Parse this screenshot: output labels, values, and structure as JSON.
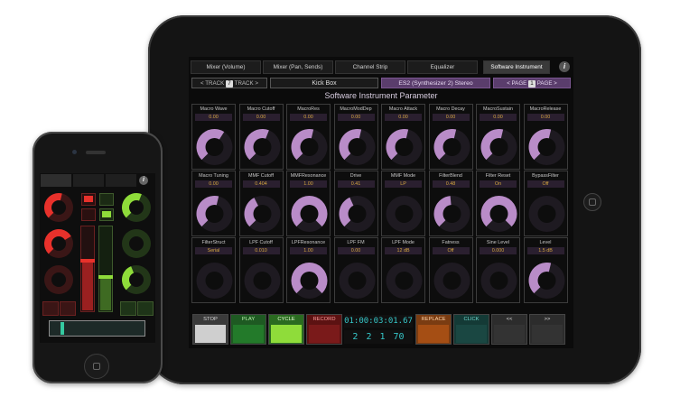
{
  "ipad": {
    "tabs": [
      {
        "label": "Mixer (Volume)",
        "active": false
      },
      {
        "label": "Mixer (Pan, Sends)",
        "active": false
      },
      {
        "label": "Channel Strip",
        "active": false
      },
      {
        "label": "Equalizer",
        "active": false
      },
      {
        "label": "Software Instrument",
        "active": true
      }
    ],
    "info_icon": "i",
    "nav": {
      "track_prev": "< TRACK",
      "track_num": "7",
      "track_next": "TRACK >",
      "track_name": "Kick Box",
      "instrument_name": "ES2  (Synthesizer 2) Stereo",
      "page_prev": "< PAGE",
      "page_num": "1",
      "page_next": "PAGE >"
    },
    "page_title": "Software Instrument Parameter",
    "params": [
      {
        "label": "Macro Wave",
        "value": "0.00",
        "level": 0.62
      },
      {
        "label": "Macro Cutoff",
        "value": "0.00",
        "level": 0.58
      },
      {
        "label": "MacroRes",
        "value": "0.00",
        "level": 0.55
      },
      {
        "label": "MacroModDep",
        "value": "0.00",
        "level": 0.55
      },
      {
        "label": "Macro Attack",
        "value": "0.00",
        "level": 0.55
      },
      {
        "label": "Macro Decay",
        "value": "0.00",
        "level": 0.55
      },
      {
        "label": "MacroSustain",
        "value": "0.00",
        "level": 0.55
      },
      {
        "label": "MacroRelease",
        "value": "0.00",
        "level": 0.55
      },
      {
        "label": "Macro Tuning",
        "value": "0.00",
        "level": 0.55
      },
      {
        "label": "MMF Cutoff",
        "value": "0.404",
        "level": 0.4
      },
      {
        "label": "MMFResonance",
        "value": "1.00",
        "level": 1.0
      },
      {
        "label": "Drive",
        "value": "0.41",
        "level": 0.41
      },
      {
        "label": "MMF Mode",
        "value": "LP",
        "level": 0.0
      },
      {
        "label": "FilterBlend",
        "value": "0.48",
        "level": 0.48
      },
      {
        "label": "Filter Reset",
        "value": "On",
        "level": 1.0
      },
      {
        "label": "BypassFilter",
        "value": "Off",
        "level": 0.0
      },
      {
        "label": "FilterStruct",
        "value": "Serial",
        "level": 0.0
      },
      {
        "label": "LPF Cutoff",
        "value": "0.010",
        "level": 0.0
      },
      {
        "label": "LPFResonance",
        "value": "1.00",
        "level": 1.0
      },
      {
        "label": "LPF FM",
        "value": "0.00",
        "level": 0.0
      },
      {
        "label": "LPF Mode",
        "value": "12 dB",
        "level": 0.0
      },
      {
        "label": "Fatness",
        "value": "Off",
        "level": 0.0
      },
      {
        "label": "Sine Level",
        "value": "0.000",
        "level": 0.0
      },
      {
        "label": "Level",
        "value": "1.5 dB",
        "level": 0.55
      }
    ],
    "transport": {
      "stop": "STOP",
      "play": "PLAY",
      "cycle": "CYCLE",
      "record": "RECORD",
      "time": "01:00:03:01.67",
      "beats": "2  2  1  70",
      "replace": "REPLACE",
      "click": "CLICK",
      "rewind": "<<",
      "forward": ">>"
    }
  },
  "iphone": {
    "info_icon": "i",
    "colors": {
      "red": "#e8312b",
      "green": "#8fdc3a",
      "teal": "#35c9a0"
    },
    "knob_levels": {
      "left": [
        0.55,
        0.72,
        0.0
      ],
      "right": [
        0.58,
        0.0,
        0.42
      ]
    },
    "fader_levels": {
      "red": 0.6,
      "green": 0.4
    },
    "scroll_position": 0.12
  }
}
